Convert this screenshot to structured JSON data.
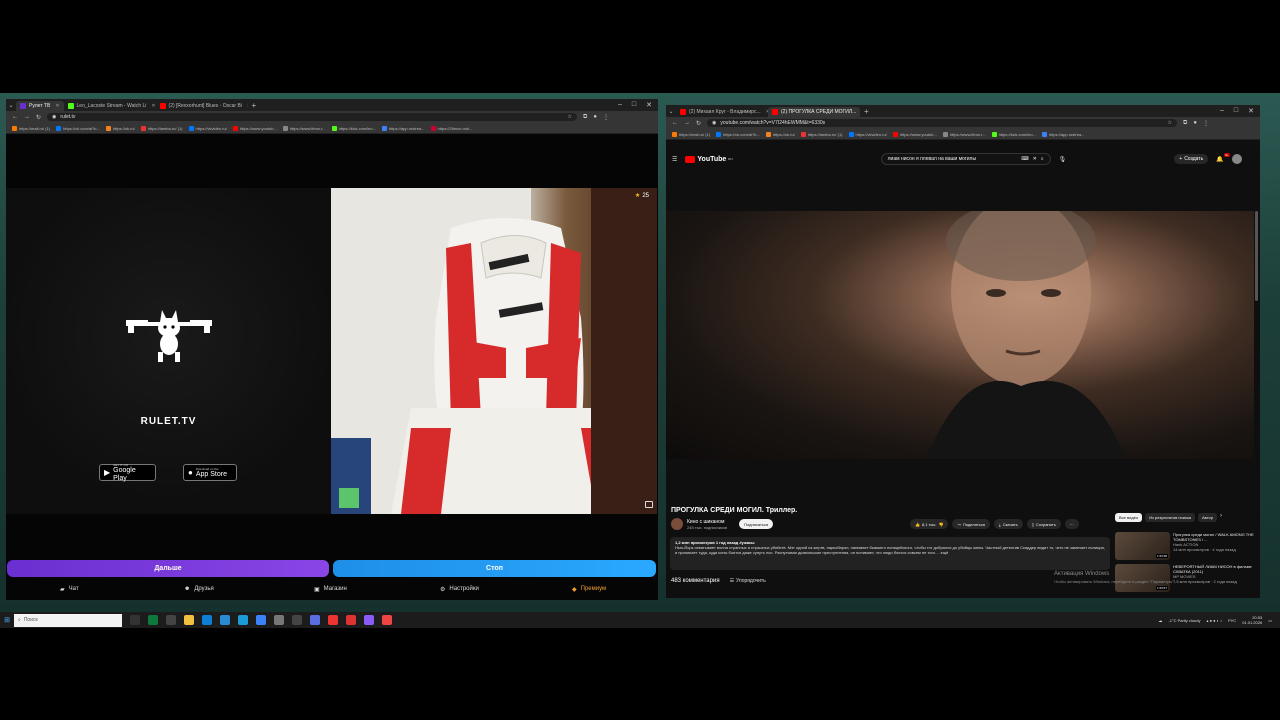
{
  "left_browser": {
    "tabs": [
      {
        "title": "Рулет ТВ",
        "active": true,
        "color": "#6a2fd0"
      },
      {
        "title": "Leo_Lacoste Stream - Watch Li",
        "active": false,
        "color": "#53fc18"
      },
      {
        "title": "(2) [Rexxorhunt] Blues - Oscar Bi",
        "active": false,
        "color": "#ff0000"
      }
    ],
    "url": "rulet.tv",
    "bookmarks": [
      "https://mail.ru/ (1)",
      "https://vk.com/al?b...",
      "https://ok.ru/",
      "https://lamba.ru/ (1)",
      "https://vkvideo.ru/",
      "https://www.youtub...",
      "https://www.lttmo.r...",
      "https://kick.com/leo...",
      "https://app.rostrea...",
      "https://2timoo.mol..."
    ]
  },
  "rulet": {
    "brand": "RULET.TV",
    "google_play": {
      "small": "GET IT ON",
      "big": "Google Play"
    },
    "app_store": {
      "small": "Download on the",
      "big": "App Store"
    },
    "star_count": "25",
    "next_label": "Дальше",
    "stop_label": "Стоп",
    "nav": {
      "chat": "Чат",
      "friends": "Друзья",
      "shop": "Магазин",
      "settings": "Настройки",
      "premium": "Премиум"
    }
  },
  "right_browser": {
    "tabs": [
      {
        "title": "(2) Михаил Круг - Владимирс...",
        "active": false,
        "color": "#ff0000"
      },
      {
        "title": "(2) ПРОГУЛКА СРЕДИ МОГИЛ...",
        "active": true,
        "color": "#ff0000"
      }
    ],
    "url": "youtube.com/watch?v=V7I24hEWMM&t=6330s",
    "bookmarks": [
      "https://mail.ru/ (1)",
      "https://vk.com/al?b...",
      "https://ok.ru/",
      "https://lamba.ru/ (1)",
      "https://vkvideo.ru/",
      "https://www.youtub...",
      "https://www.lttmo.r...",
      "https://kick.com/leo...",
      "https://app.rostrea..."
    ]
  },
  "youtube": {
    "logo": "YouTube",
    "logo_region": "RU",
    "search_query": "лиам нисон я плевал на ваши могилы",
    "create_label": "Создать",
    "notif_count": "9+",
    "video_title": "ПРОГУЛКА СРЕДИ МОГИЛ. Триллер.",
    "channel_name": "Кино с шиканом",
    "channel_subs": "245 тыс. подписчиков",
    "subscribe": "Подписаться",
    "likes": "8,1 тыс.",
    "share": "Поделиться",
    "download": "Скачать",
    "save": "Сохранить",
    "chips": [
      "Все видео",
      "Из результатов поиска",
      "Автор"
    ],
    "desc_meta": "1,2 млн просмотров  1 год назад  #ужасы",
    "desc_text": "Нью-Йорк охватывает волна странных и страшных убийств. Мэт одной из жертв, наркобарон, нанимает бывшего полицейского, чтобы тот добрался до убийцы жены. Частный детектив Скаддер видит то, чего не замечает полиция, и проникает туда, куда копы боятся даже сунуть нос. Распутывая дьявольские преступления, он понимает, что люди боятся совсем не того. ...ещё",
    "comments_count": "483 комментария",
    "sort_label": "Упорядочить",
    "recommendations": [
      {
        "title": "Прогулка среди могил / WALK AMONG THE TOMBSTONES / ...",
        "channel": "Hank ACTION",
        "meta": "14 млн просмотров · 4 года назад",
        "duration": "1:53:58"
      },
      {
        "title": "НЕВЕРОЯТНЫЙ ЛИАМ НИСОН в фильме СХВАТКА (2011)",
        "channel": "MP MOVIES",
        "meta": "7,5 млн просмотров · 2 года назад",
        "duration": "1:53:57"
      }
    ],
    "activation_title": "Активация Windows",
    "activation_sub": "Чтобы активировать Windows, перейдите в раздел \"Параметры\"."
  },
  "taskbar": {
    "search_placeholder": "Поиск",
    "weather": "-1°C  Partly cloudy",
    "lang": "РУС",
    "time": "20:53",
    "date": "01.01.2026"
  }
}
